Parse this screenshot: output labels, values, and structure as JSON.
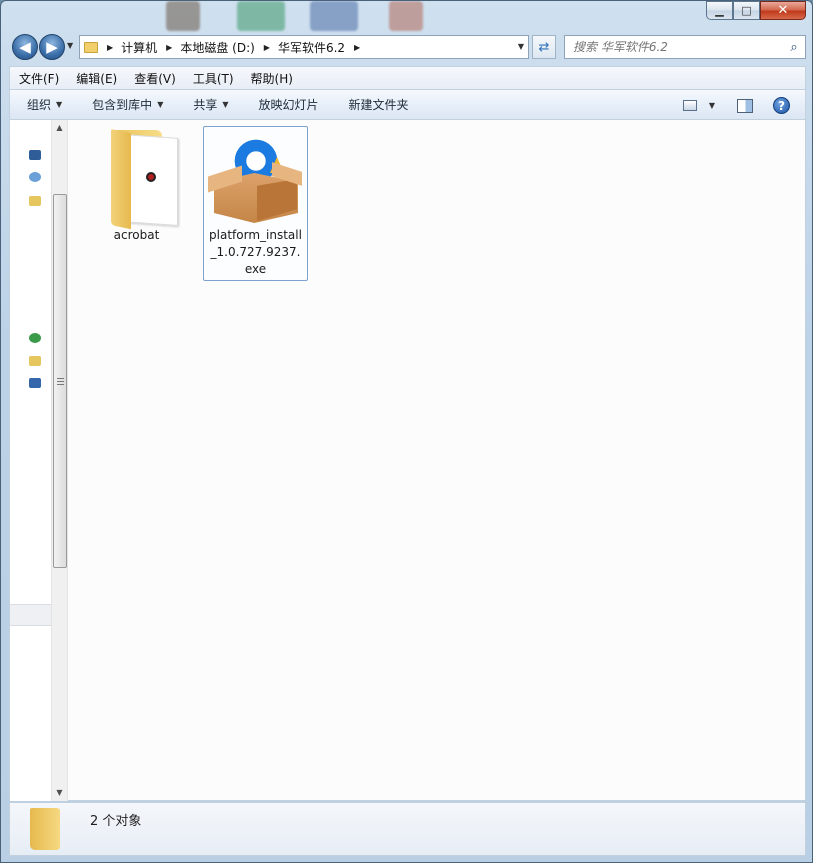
{
  "window": {
    "minimize_glyph": "▁",
    "maximize_glyph": "□",
    "close_glyph": "✕"
  },
  "navigation": {
    "back_glyph": "◀",
    "forward_glyph": "▶",
    "breadcrumbs": [
      "计算机",
      "本地磁盘 (D:)",
      "华军软件6.2"
    ],
    "search_placeholder": "搜索 华军软件6.2"
  },
  "menu": {
    "items": [
      "文件(F)",
      "编辑(E)",
      "查看(V)",
      "工具(T)",
      "帮助(H)"
    ]
  },
  "commands": {
    "organize": "组织",
    "include_in_library": "包含到库中",
    "share": "共享",
    "slideshow": "放映幻灯片",
    "new_folder": "新建文件夹",
    "help_glyph": "?"
  },
  "files": [
    {
      "name": "acrobat",
      "type": "folder",
      "icon": "folder-icon"
    },
    {
      "name": "platform_install_1.0.727.9237.exe",
      "type": "exe",
      "icon": "installer-package-icon",
      "selected": true
    }
  ],
  "status": {
    "item_count": "2 个对象"
  },
  "colors": {
    "accent": "#2f6fb5",
    "selection_border": "#7da2ce"
  }
}
